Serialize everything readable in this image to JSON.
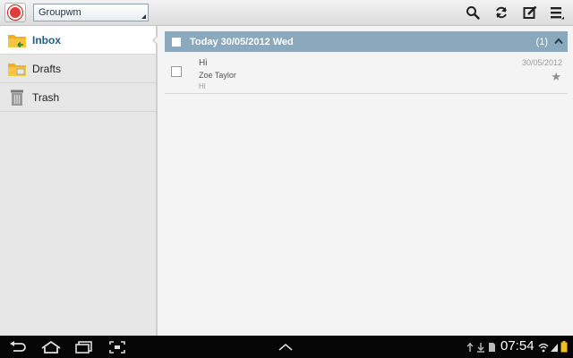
{
  "toolbar": {
    "app_icon": "email-app-icon",
    "account": "Groupwm",
    "actions": [
      "search-icon",
      "refresh-icon",
      "compose-icon",
      "menu-icon"
    ]
  },
  "folders": [
    {
      "label": "Inbox",
      "icon": "inbox-folder-icon",
      "active": true
    },
    {
      "label": "Drafts",
      "icon": "drafts-folder-icon",
      "active": false
    },
    {
      "label": "Trash",
      "icon": "trash-icon",
      "active": false
    }
  ],
  "group": {
    "label": "Today  30/05/2012 Wed",
    "count": "(1)",
    "color": "#8ba9bd"
  },
  "messages": [
    {
      "subject": "Hi",
      "sender": "Zoe Taylor",
      "preview": "Hi",
      "date": "30/05/2012",
      "starred": false
    }
  ],
  "status_bar": {
    "time": "07:54",
    "nav": [
      "back-icon",
      "home-icon",
      "recent-apps-icon",
      "screenshot-icon",
      "up-chevron-icon"
    ],
    "indicators": [
      "usb-icon",
      "download-icon",
      "sd-card-icon",
      "wifi-icon",
      "signal-icon",
      "battery-icon"
    ]
  }
}
